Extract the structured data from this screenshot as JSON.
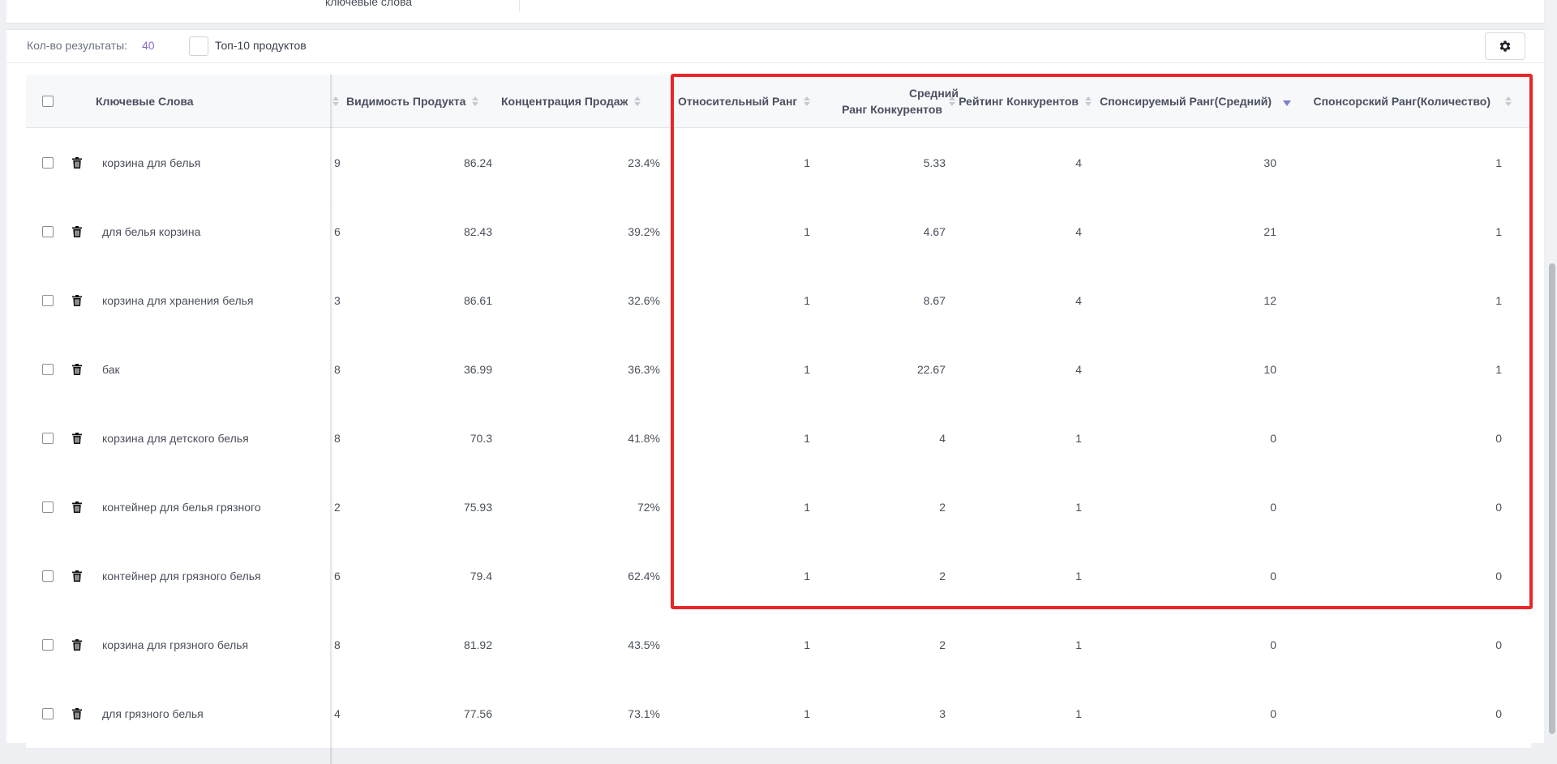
{
  "top_strip": {
    "cut_text": "ключевые слова"
  },
  "toolbar": {
    "results_label": "Кол-во результаты:",
    "results_count": "40",
    "top10_label": "Топ-10 продуктов",
    "settings_icon": "gear-icon"
  },
  "table": {
    "headers": {
      "keywords": "Ключевые Слова",
      "visibility": "Видимость Продукта",
      "concentration": "Концентрация Продаж",
      "relative_rank": "Относительный Ранг",
      "avg_comp_rank_line1": "Средний",
      "avg_comp_rank_line2": "Ранг Конкурентов",
      "comp_rating": "Рейтинг Конкурентов",
      "sponsored_avg": "Спонсируемый Ранг(Средний)",
      "sponsored_count": "Спонсорский Ранг(Количество)"
    },
    "rows": [
      {
        "keyword": "корзина для белья",
        "cut": "9",
        "visibility": "86.24",
        "concentration": "23.4%",
        "relative_rank": "1",
        "avg_comp_rank": "5.33",
        "comp_rating": "4",
        "sponsored_avg": "30",
        "sponsored_count": "1"
      },
      {
        "keyword": "для белья корзина",
        "cut": "6",
        "visibility": "82.43",
        "concentration": "39.2%",
        "relative_rank": "1",
        "avg_comp_rank": "4.67",
        "comp_rating": "4",
        "sponsored_avg": "21",
        "sponsored_count": "1"
      },
      {
        "keyword": "корзина для хранения белья",
        "cut": "3",
        "visibility": "86.61",
        "concentration": "32.6%",
        "relative_rank": "1",
        "avg_comp_rank": "8.67",
        "comp_rating": "4",
        "sponsored_avg": "12",
        "sponsored_count": "1"
      },
      {
        "keyword": "бак",
        "cut": "8",
        "visibility": "36.99",
        "concentration": "36.3%",
        "relative_rank": "1",
        "avg_comp_rank": "22.67",
        "comp_rating": "4",
        "sponsored_avg": "10",
        "sponsored_count": "1"
      },
      {
        "keyword": "корзина для детского белья",
        "cut": "8",
        "visibility": "70.3",
        "concentration": "41.8%",
        "relative_rank": "1",
        "avg_comp_rank": "4",
        "comp_rating": "1",
        "sponsored_avg": "0",
        "sponsored_count": "0"
      },
      {
        "keyword": "контейнер для белья грязного",
        "cut": "2",
        "visibility": "75.93",
        "concentration": "72%",
        "relative_rank": "1",
        "avg_comp_rank": "2",
        "comp_rating": "1",
        "sponsored_avg": "0",
        "sponsored_count": "0"
      },
      {
        "keyword": "контейнер для грязного белья",
        "cut": "6",
        "visibility": "79.4",
        "concentration": "62.4%",
        "relative_rank": "1",
        "avg_comp_rank": "2",
        "comp_rating": "1",
        "sponsored_avg": "0",
        "sponsored_count": "0"
      },
      {
        "keyword": "корзина для грязного белья",
        "cut": "8",
        "visibility": "81.92",
        "concentration": "43.5%",
        "relative_rank": "1",
        "avg_comp_rank": "2",
        "comp_rating": "1",
        "sponsored_avg": "0",
        "sponsored_count": "0"
      },
      {
        "keyword": "для грязного белья",
        "cut": "4",
        "visibility": "77.56",
        "concentration": "73.1%",
        "relative_rank": "1",
        "avg_comp_rank": "3",
        "comp_rating": "1",
        "sponsored_avg": "0",
        "sponsored_count": "0"
      }
    ]
  },
  "colors": {
    "accent": "#8b6cc7",
    "highlight": "#e8262a",
    "sort_active": "#7b7fc9"
  }
}
